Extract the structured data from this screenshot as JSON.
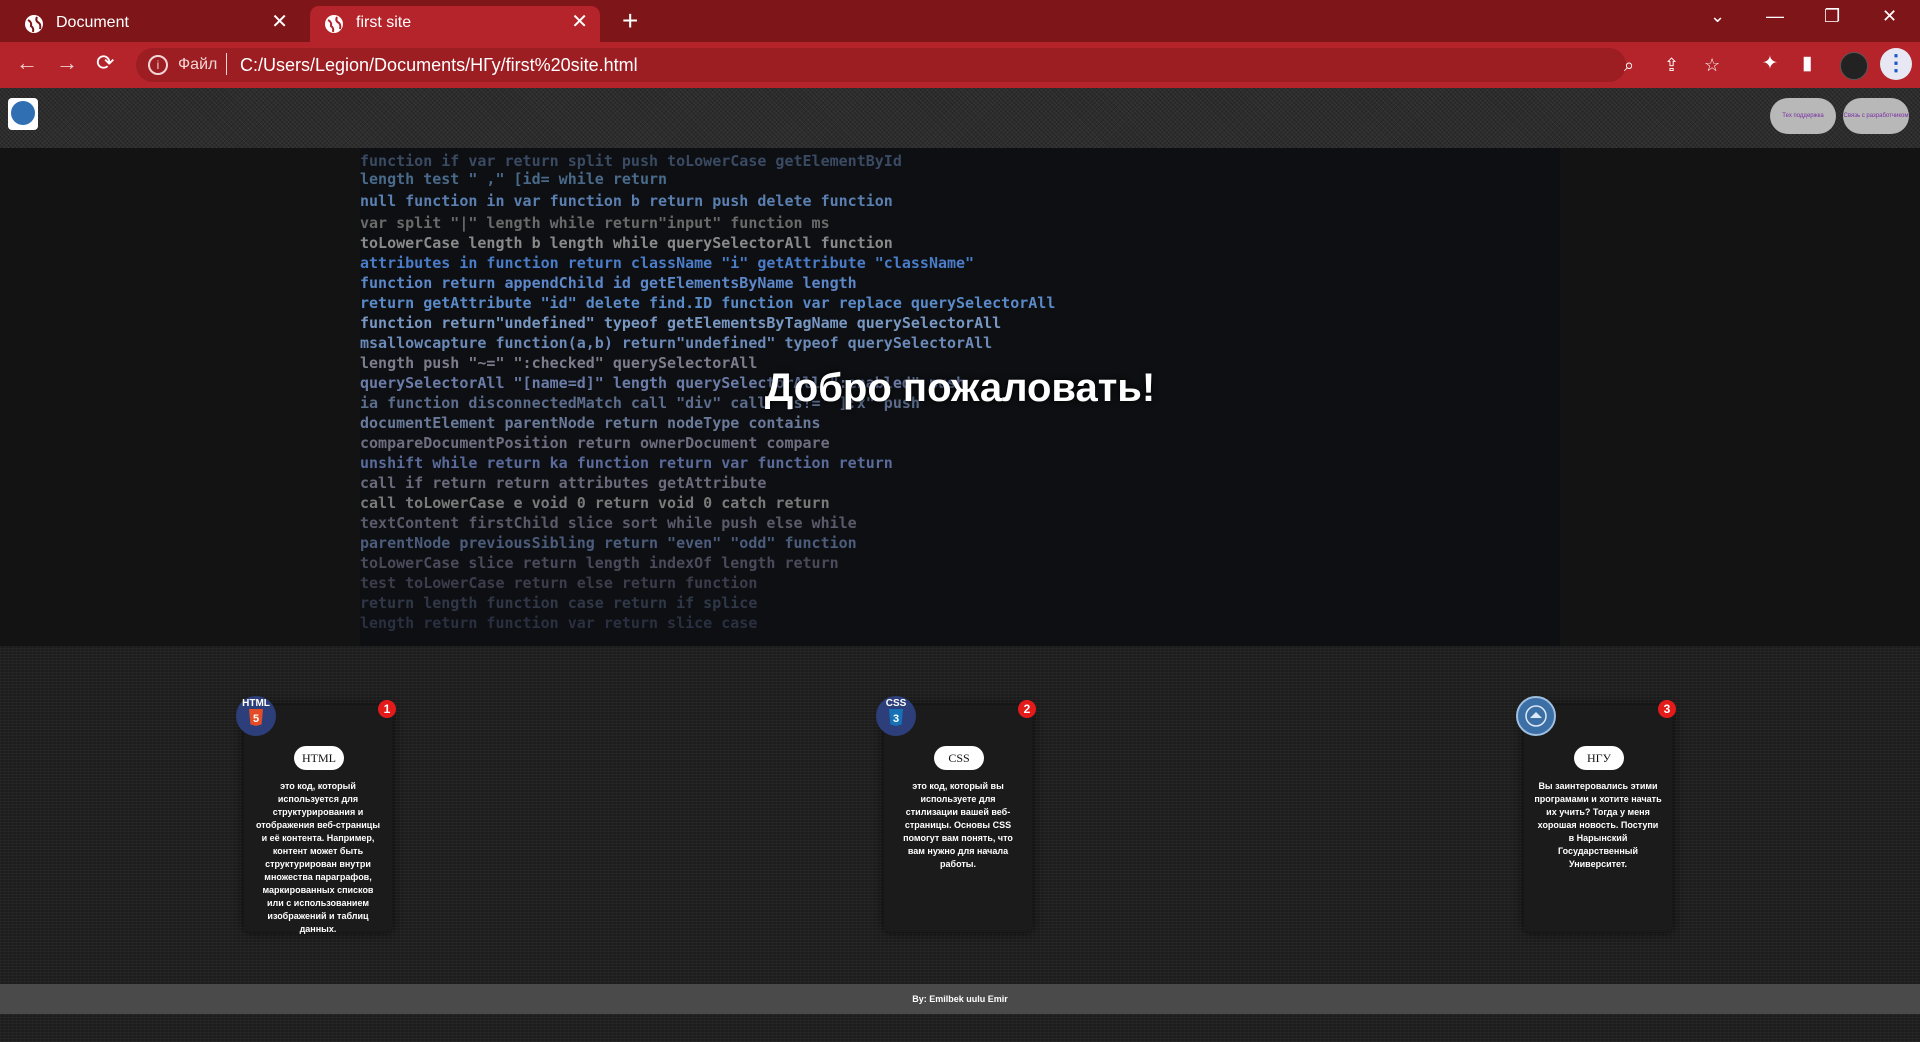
{
  "browser": {
    "tabs": [
      {
        "title": "Document",
        "active": false
      },
      {
        "title": "first site",
        "active": true
      }
    ],
    "address": {
      "file_label": "Файл",
      "url": "C:/Users/Legion/Documents/НГу/first%20site.html"
    },
    "colors": {
      "tabbar": "#7e1519",
      "toolbar": "#b5242a"
    }
  },
  "site": {
    "header_buttons": [
      {
        "label": "Тех поддержка"
      },
      {
        "label": "Связь с разработчиком"
      }
    ],
    "hero_title": "Добро пожаловать!",
    "cards": [
      {
        "number": "1",
        "icon_text": "HTML",
        "label": "HTML",
        "text": "это код, который используется для структурирования и отображения веб-страницы и её контента. Например, контент может быть структурирован внутри множества параграфов, маркированных списков или с использованием изображений и таблиц данных."
      },
      {
        "number": "2",
        "icon_text": "CSS",
        "label": "CSS",
        "text": "это код, который вы используете для стилизации вашей веб-страницы. Основы CSS помогут вам понять, что вам нужно для начала работы."
      },
      {
        "number": "3",
        "icon_text": "",
        "label": "НГУ",
        "text": "Вы заинтеровались этими програмами и хотите начать их учить? Тогда у меня хорошая новость. Поступи в Нарынский Государственный Университет."
      }
    ],
    "footer": "By: Emilbek uulu Emir"
  }
}
